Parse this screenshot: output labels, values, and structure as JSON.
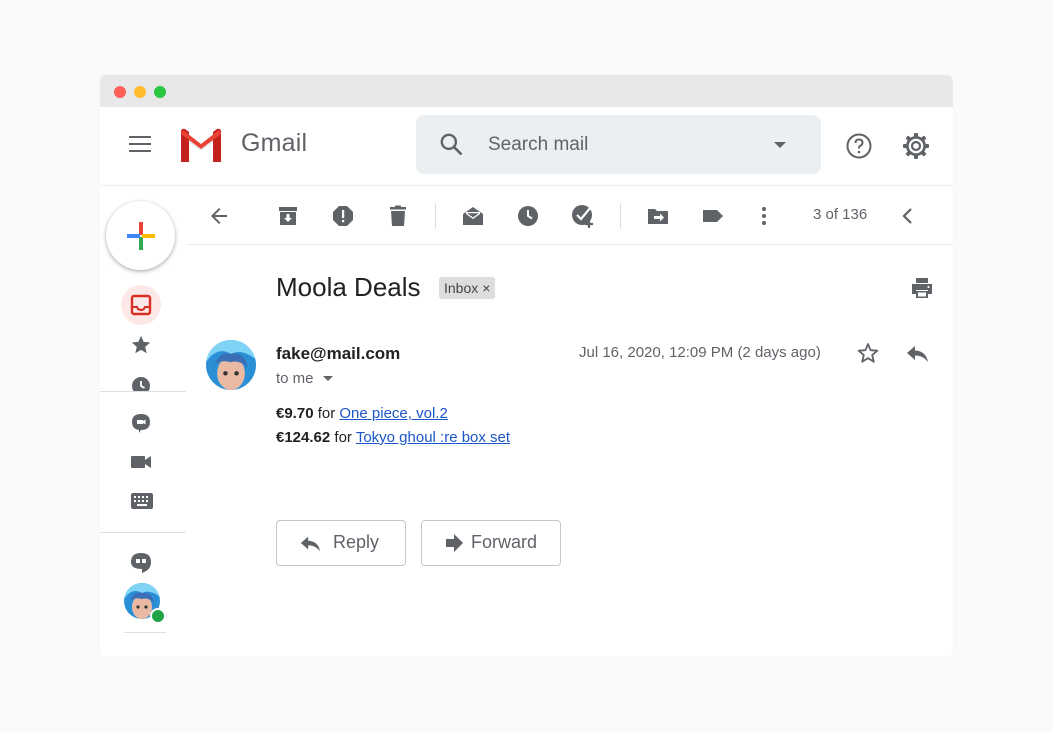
{
  "app": {
    "name": "Gmail"
  },
  "search": {
    "placeholder": "Search mail"
  },
  "toolbar": {
    "page_count": "3 of 136"
  },
  "message": {
    "subject": "Moola Deals",
    "label_chip": "Inbox",
    "label_chip_close": "×",
    "sender": "fake@mail.com",
    "recipient": "to me",
    "date": "Jul 16, 2020, 12:09 PM (2 days ago)",
    "lines": [
      {
        "price": "€9.70",
        "connector": " for ",
        "link_text": "One piece, vol.2"
      },
      {
        "price": "€124.62",
        "connector": " for ",
        "link_text": "Tokyo ghoul :re box set"
      }
    ]
  },
  "actions": {
    "reply": "Reply",
    "forward": "Forward"
  },
  "colors": {
    "gmail_red": "#d93025",
    "link": "#1a56c6",
    "icon_gray": "#5f6368",
    "online": "#1ea446"
  }
}
